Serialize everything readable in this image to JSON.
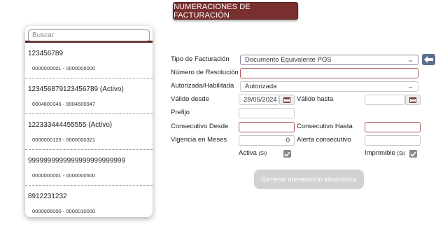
{
  "header": {
    "title": "NUMERACIONES DE FACTURACIÓN"
  },
  "search": {
    "placeholder": "Buscar"
  },
  "list": [
    {
      "name": "123456789",
      "range": "0000000001 - 0000005000"
    },
    {
      "name": "123456879123456789 (Activo)",
      "range": "0004600346 - 0004600947"
    },
    {
      "name": "122333444455555 (Activo)",
      "range": "0000000123 - 0000000321"
    },
    {
      "name": "9999999999999999999999999",
      "range": "0000000001 - 0000000500"
    },
    {
      "name": "8912231232",
      "range": "0000005000 - 0000010000"
    }
  ],
  "form": {
    "tipo_label": "Tipo de Facturación",
    "tipo_value": "Documento Equivalente POS",
    "resolucion_label": "Número de Resolución",
    "resolucion_value": "",
    "autorizada_label": "Autorizada/Habilitada",
    "autorizada_value": "Autorizada",
    "valido_desde_label": "Válido desde",
    "valido_desde_value": "28/05/2024",
    "valido_hasta_label": "Válido hasta",
    "valido_hasta_value": "",
    "prefijo_label": "Prefijo",
    "prefijo_value": "",
    "consec_desde_label": "Consecutivo Desde",
    "consec_hasta_label": "Consecutivo Hasta",
    "vigencia_label": "Vigencia en Meses",
    "vigencia_value": "0",
    "alerta_label": "Alerta consecutivo",
    "activa_label": "Activa",
    "activa_si": "(Si)",
    "imprimible_label": "Imprimible",
    "imprimible_si": "(Si)",
    "generate_label": "Generar numeración electrónica"
  },
  "icons": {
    "back": "arrow-left-icon",
    "calendar": "calendar-icon",
    "check": "checkmark-icon",
    "chevron": "chevron-down-icon"
  },
  "colors": {
    "accent": "#7a2f2f",
    "back_button": "#5e6f8c",
    "required_border": "#b05a5a"
  }
}
